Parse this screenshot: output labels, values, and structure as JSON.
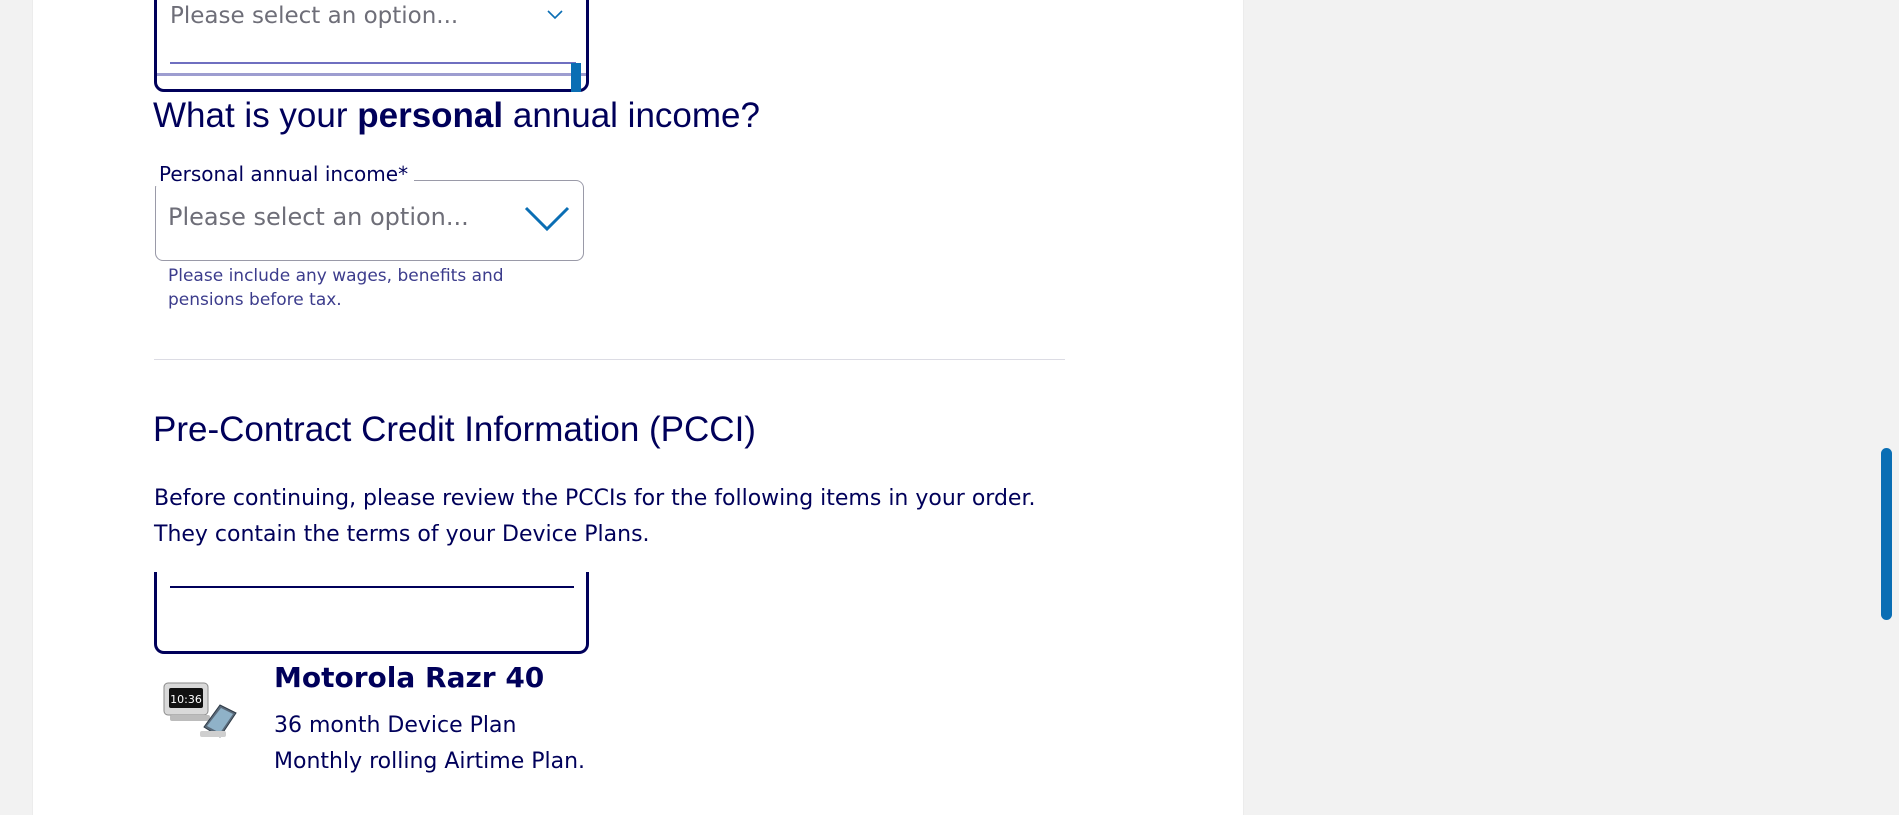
{
  "top_select": {
    "placeholder": "Please select an option..."
  },
  "income": {
    "heading_prefix": "What is your ",
    "heading_bold": "personal",
    "heading_suffix": " annual income?",
    "label": "Personal annual income*",
    "placeholder": "Please select an option...",
    "help": "Please include any wages, benefits and pensions before tax."
  },
  "pcci": {
    "heading": "Pre-Contract Credit Information (PCCI)",
    "line1": "Before continuing, please review the PCCIs for the following items in your order.",
    "line2": "They contain the terms of your Device Plans."
  },
  "product": {
    "name": "Motorola Razr 40",
    "line1": "36 month Device Plan",
    "line2": "Monthly rolling Airtime Plan.",
    "image_text": "10:36"
  },
  "colors": {
    "navy": "#00005a",
    "accent_blue": "#0a6eb4",
    "placeholder_gray": "#6e6e78",
    "page_bg": "#f2f2f2"
  }
}
